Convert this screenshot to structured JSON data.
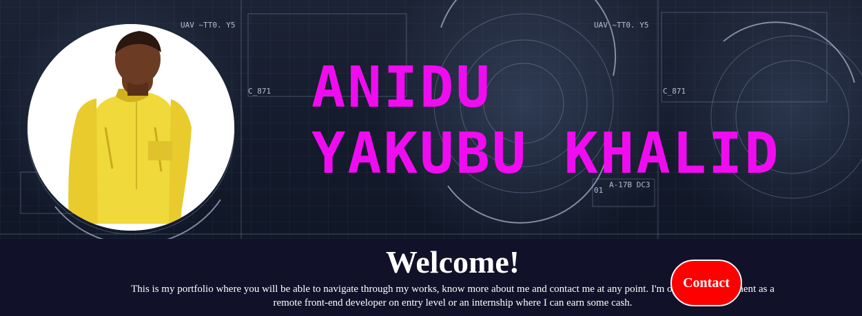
{
  "hero": {
    "name_line1": "ANIDU",
    "name_line2": "YAKUBU KHALID",
    "hud_label_1": "UAV ~TT0. Y5",
    "hud_label_2": "C_871",
    "hud_label_3": "A-17B DC3",
    "hud_label_4": "01",
    "hud_label_5": "UAV ~TT0. Y5",
    "hud_label_6": "C_871"
  },
  "profile": {
    "alt": "Profile photo of Anidu Yakubu Khalid"
  },
  "welcome": {
    "heading": "Welcome!",
    "intro": "This is my portfolio where you will be able to navigate through my works, know more about me and contact me at any point. I'm open for employment as a remote front-end developer on entry level or an internship where I can earn some cash."
  },
  "contact": {
    "label": "Contact"
  },
  "colors": {
    "name": "#f00cf0",
    "contact_button": "#ff0000",
    "background": "#111129"
  }
}
